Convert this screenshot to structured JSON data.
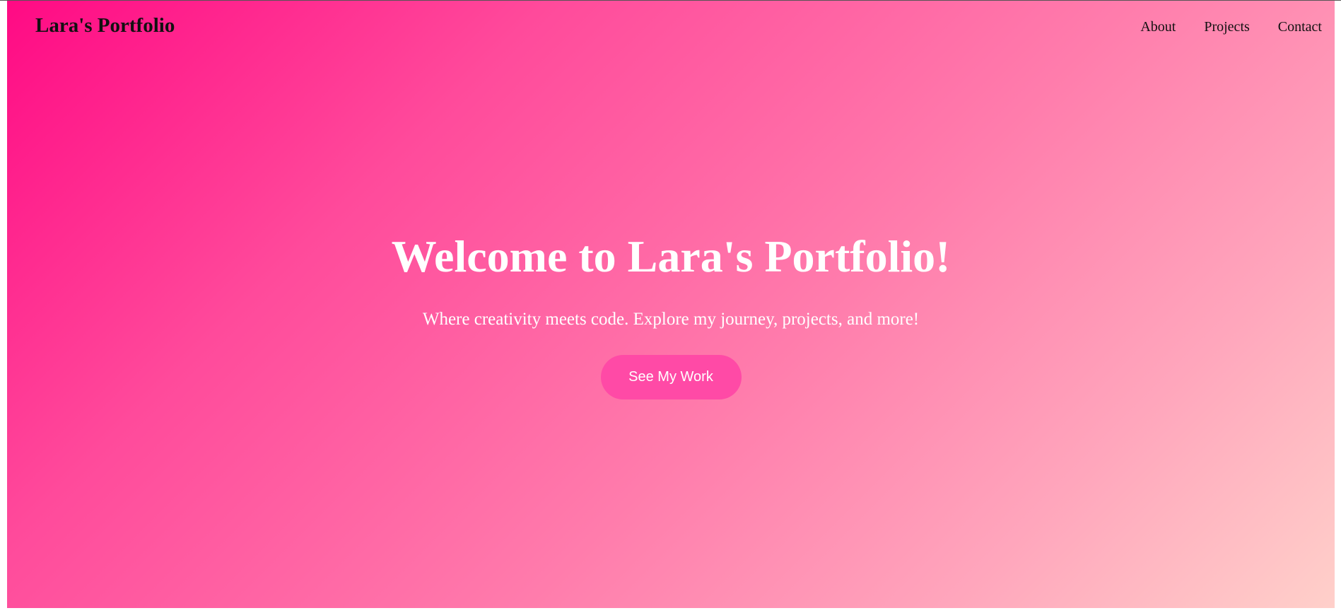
{
  "navbar": {
    "brand": "Lara's Portfolio",
    "links": [
      {
        "label": "About"
      },
      {
        "label": "Projects"
      },
      {
        "label": "Contact"
      }
    ]
  },
  "hero": {
    "title": "Welcome to Lara's Portfolio!",
    "subtitle": "Where creativity meets code. Explore my journey, projects, and more!",
    "cta_label": "See My Work"
  },
  "colors": {
    "gradient_start": "#ff0a84",
    "gradient_end": "#ffd0ca",
    "button": "#ff4aa6",
    "hero_text": "#ffffff",
    "nav_text": "#111111"
  }
}
